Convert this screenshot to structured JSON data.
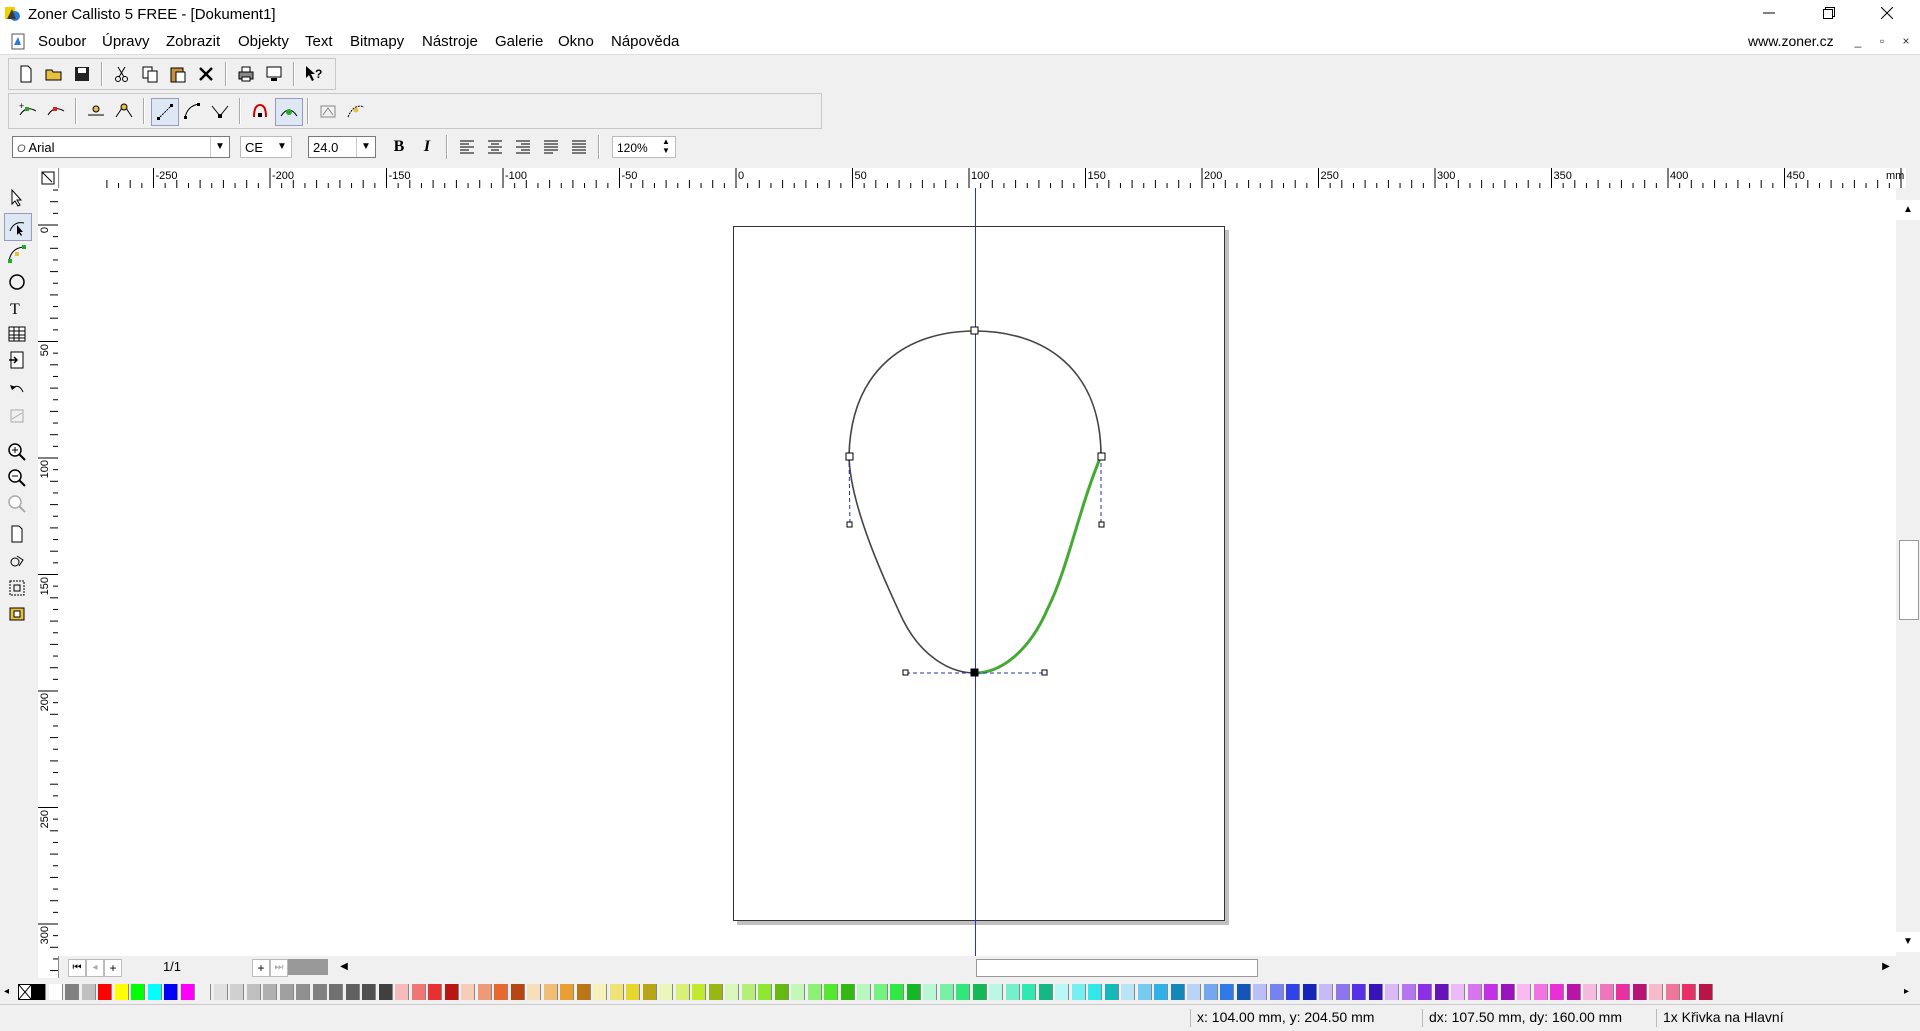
{
  "window": {
    "title": "Zoner Callisto 5 FREE - [Dokument1]",
    "minimize": "—",
    "maximize": "❐",
    "close": "✕"
  },
  "menu": {
    "items": [
      "Soubor",
      "Úpravy",
      "Zobrazit",
      "Objekty",
      "Text",
      "Bitmapy",
      "Nástroje",
      "Galerie",
      "Okno",
      "Nápověda"
    ],
    "url": "www.zoner.cz"
  },
  "textbar": {
    "font": "Arial",
    "charset": "CE",
    "size": "24.0",
    "bold": "B",
    "italic": "I",
    "line_spacing": "120%"
  },
  "rulers": {
    "unit": "mm",
    "h_labels": [
      "-250",
      "-200",
      "-150",
      "-100",
      "-50",
      "0",
      "50",
      "100",
      "150",
      "200",
      "250",
      "300",
      "350",
      "400",
      "450"
    ],
    "v_labels": [
      "0",
      "50",
      "100",
      "150",
      "200",
      "250",
      "300"
    ]
  },
  "pager": {
    "page_indicator": "1/1"
  },
  "colors": {
    "curve": "#444444",
    "selected_segment": "#44aa33",
    "guide": "#2233dd",
    "handle_line": "#2233aa"
  },
  "status": {
    "coords": "x: 104.00 mm, y: 204.50 mm",
    "delta": "dx: 107.50 mm, dy: 160.00 mm",
    "selection": "1x Křivka na Hlavní"
  }
}
